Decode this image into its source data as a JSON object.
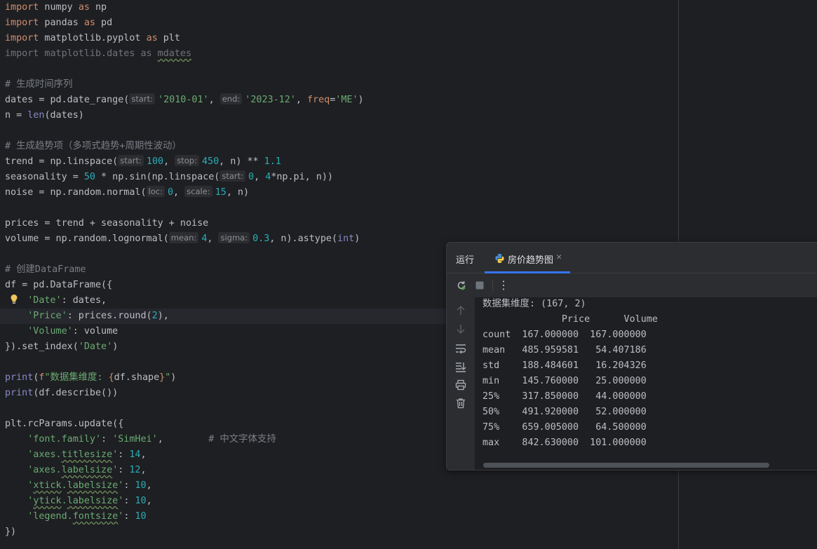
{
  "editor": {
    "lines": [
      {
        "html": "<span class='kw'>import</span> numpy <span class='kw'>as</span> np"
      },
      {
        "html": "<span class='kw'>import</span> pandas <span class='kw'>as</span> pd"
      },
      {
        "html": "<span class='kw'>import</span> matplotlib.pyplot <span class='kw'>as</span> plt"
      },
      {
        "html": "<span class='unused'>import matplotlib.dates as <span class='squig'>mdates</span></span>"
      },
      {
        "html": ""
      },
      {
        "html": "<span class='cmt'># 生成时间序列</span>"
      },
      {
        "html": "dates = pd.date_range(<span class='hint'>start:</span><span class='str'>'2010-01'</span>, <span class='hint'>end:</span><span class='str'>'2023-12'</span>, <span class='fmt'>freq</span>=<span class='str'>'ME'</span>)"
      },
      {
        "html": "n = <span class='bi'>len</span>(dates)"
      },
      {
        "html": ""
      },
      {
        "html": "<span class='cmt'># 生成趋势项（多项式趋势+周期性波动）</span>"
      },
      {
        "html": "trend = np.linspace(<span class='hint'>start:</span><span class='num'>100</span>, <span class='hint'>stop:</span><span class='num'>450</span>, n) ** <span class='num'>1.1</span>"
      },
      {
        "html": "seasonality = <span class='num'>50</span> * np.sin(np.linspace(<span class='hint'>start:</span><span class='num'>0</span>, <span class='num'>4</span>*np.pi, n))"
      },
      {
        "html": "noise = np.random.normal(<span class='hint'>loc:</span><span class='num'>0</span>, <span class='hint'>scale:</span><span class='num'>15</span>, n)"
      },
      {
        "html": ""
      },
      {
        "html": "prices = trend + seasonality + noise"
      },
      {
        "html": "volume = np.random.lognormal(<span class='hint'>mean:</span><span class='num'>4</span>, <span class='hint'>sigma:</span><span class='num'>0.3</span>, n).astype(<span class='bi'>int</span>)"
      },
      {
        "html": ""
      },
      {
        "html": "<span class='cmt'># 创建DataFrame</span>"
      },
      {
        "html": "df = pd.DataFrame({"
      },
      {
        "html": "    <span class='str'>'Date'</span>: dates,"
      },
      {
        "html": "    <span class='str'>'Price'</span>: prices.round(<span class='num'>2</span>),"
      },
      {
        "html": "    <span class='str'>'Volume'</span>: volume"
      },
      {
        "html": "}).set_index(<span class='str'>'Date'</span>)"
      },
      {
        "html": ""
      },
      {
        "html": "<span class='bi'>print</span>(<span class='fmt'>f</span><span class='str'>\"数据集维度: </span><span class='fmt'>{</span>df.shape<span class='fmt'>}</span><span class='str'>\"</span>)"
      },
      {
        "html": "<span class='bi'>print</span>(df.describe())"
      },
      {
        "html": ""
      },
      {
        "html": "plt.rcParams.update({"
      },
      {
        "html": "    <span class='str'>'font.family'</span>: <span class='str'>'SimHei'</span>,        <span class='cmt'># 中文字体支持</span>"
      },
      {
        "html": "    <span class='str'>'axes.<span class='squig'>titlesize</span>'</span>: <span class='num'>14</span>,"
      },
      {
        "html": "    <span class='str'>'axes.<span class='squig'>labelsize</span>'</span>: <span class='num'>12</span>,"
      },
      {
        "html": "    <span class='str'>'<span class='squig'>xtick</span>.<span class='squig'>labelsize</span>'</span>: <span class='num'>10</span>,"
      },
      {
        "html": "    <span class='str'>'<span class='squig'>ytick</span>.<span class='squig'>labelsize</span>'</span>: <span class='num'>10</span>,"
      },
      {
        "html": "    <span class='str'>'legend.<span class='squig'>fontsize</span>'</span>: <span class='num'>10</span>"
      },
      {
        "html": "})"
      }
    ]
  },
  "run_panel": {
    "title": "运行",
    "tab_label": "房价趋势图",
    "tab_close": "×",
    "toolbar": {
      "menu": "⋮"
    },
    "output": [
      "数据集维度: (167, 2)",
      "              Price      Volume",
      "count  167.000000  167.000000",
      "mean   485.959581   54.407186",
      "std    188.484601   16.204326",
      "min    145.760000   25.000000",
      "25%    317.850000   44.000000",
      "50%    491.920000   52.000000",
      "75%    659.005000   64.500000",
      "max    842.630000  101.000000"
    ]
  }
}
